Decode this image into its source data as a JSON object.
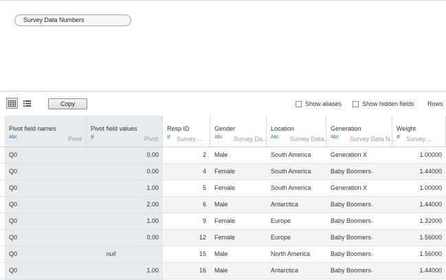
{
  "datasource_pill": "Survey Data Numbers",
  "toolbar": {
    "copy_label": "Copy",
    "show_aliases_label": "Show aliases",
    "show_hidden_fields_label": "Show hidden fields",
    "rows_label": "Rows"
  },
  "columns": [
    {
      "name": "Pivot field names",
      "type": "Abc",
      "sub": "Pivot"
    },
    {
      "name": "Pivot field values",
      "type": "#",
      "sub": "Pivot"
    },
    {
      "name": "Resp ID",
      "type": "#",
      "sub": "Survey ..."
    },
    {
      "name": "Gender",
      "type": "Abc",
      "sub": "Survey Da..."
    },
    {
      "name": "Location",
      "type": "Abc",
      "sub": "Survey Data..."
    },
    {
      "name": "Generation",
      "type": "Abc",
      "sub": "Survey Data N..."
    },
    {
      "name": "Weight",
      "type": "#",
      "sub": "Survey ..."
    }
  ],
  "rows": [
    [
      "Q0",
      "0.00",
      "2",
      "Male",
      "South America",
      "Generation X",
      "1.00000"
    ],
    [
      "Q0",
      "0.00",
      "4",
      "Female",
      "South America",
      "Baby Boomers",
      "1.44000"
    ],
    [
      "Q0",
      "1.00",
      "5",
      "Female",
      "South America",
      "Generation X",
      "1.00000"
    ],
    [
      "Q0",
      "2.00",
      "6",
      "Male",
      "Antarctica",
      "Baby Boomers",
      "1.44000"
    ],
    [
      "Q0",
      "1.00",
      "9",
      "Female",
      "Europe",
      "Baby Boomers",
      "1.32000"
    ],
    [
      "Q0",
      "0.00",
      "12",
      "Female",
      "Europe",
      "Baby Boomers",
      "1.56000"
    ],
    [
      "Q0",
      "null",
      "15",
      "Male",
      "North America",
      "Baby Boomers",
      "1.56000"
    ],
    [
      "Q0",
      "1.00",
      "16",
      "Male",
      "Antarctica",
      "Baby Boomers",
      "1.44000"
    ]
  ]
}
